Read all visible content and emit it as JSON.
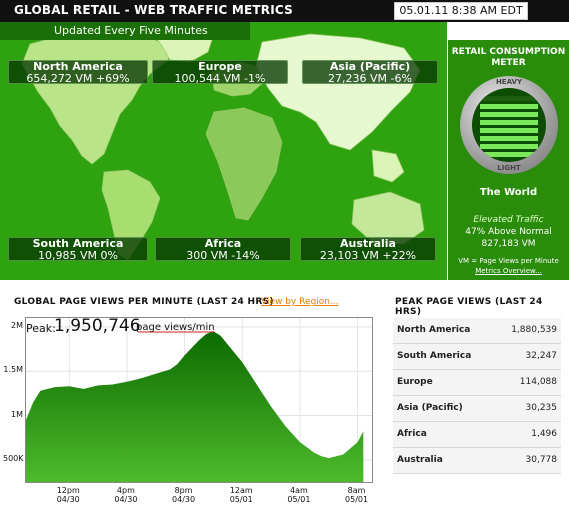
{
  "header": {
    "title": "GLOBAL RETAIL - WEB TRAFFIC METRICS",
    "datetime": "05.01.11 8:38 AM EDT"
  },
  "map": {
    "updated": "Updated Every Five Minutes",
    "regions": [
      {
        "name": "North America",
        "value": "654,272 VM +69%"
      },
      {
        "name": "Europe",
        "value": "100,544 VM -1%"
      },
      {
        "name": "Asia (Pacific)",
        "value": "27,236 VM -6%"
      },
      {
        "name": "South America",
        "value": "10,985 VM 0%"
      },
      {
        "name": "Africa",
        "value": "300 VM -14%"
      },
      {
        "name": "Australia",
        "value": "23,103 VM +22%"
      }
    ]
  },
  "meter": {
    "title_line1": "RETAIL CONSUMPTION",
    "title_line2": "METER",
    "heavy": "HEAVY",
    "light": "LIGHT",
    "level": 0.85,
    "world": "The World",
    "status": "Elevated Traffic",
    "status_detail": "47% Above Normal",
    "total": "827,183 VM",
    "legend": "VM = Page Views per Minute",
    "overview_link": "Metrics Overview..."
  },
  "chart_section": {
    "title": "GLOBAL PAGE VIEWS PER MINUTE (LAST 24 HRS)",
    "region_link": "View by Region...",
    "peak_label": "Peak:",
    "peak_value": "1,950,746",
    "peak_unit": "page views/min"
  },
  "chart_data": {
    "type": "area",
    "title": "GLOBAL PAGE VIEWS PER MINUTE (LAST 24 HRS)",
    "xlabel": "",
    "ylabel": "",
    "ylim": [
      250000,
      2100000
    ],
    "yticks": [
      {
        "label": "2M",
        "value": 2000000
      },
      {
        "label": "1.5M",
        "value": 1500000
      },
      {
        "label": "1M",
        "value": 1000000
      },
      {
        "label": "500K",
        "value": 500000
      }
    ],
    "xticks": [
      {
        "time": "12pm",
        "date": "04/30",
        "hour": 3
      },
      {
        "time": "4pm",
        "date": "04/30",
        "hour": 7
      },
      {
        "time": "8pm",
        "date": "04/30",
        "hour": 11
      },
      {
        "time": "12am",
        "date": "05/01",
        "hour": 15
      },
      {
        "time": "4am",
        "date": "05/01",
        "hour": 19
      },
      {
        "time": "8am",
        "date": "05/01",
        "hour": 23
      }
    ],
    "x_hours": [
      0,
      0.5,
      1,
      2,
      3,
      4,
      5,
      6,
      7,
      8,
      9,
      10,
      10.5,
      11,
      12,
      12.5,
      13,
      13.5,
      14,
      15,
      16,
      17,
      18,
      19,
      20,
      20.5,
      21,
      22,
      23,
      23.4
    ],
    "values": [
      950000,
      1150000,
      1280000,
      1320000,
      1330000,
      1300000,
      1340000,
      1350000,
      1380000,
      1420000,
      1470000,
      1520000,
      1580000,
      1680000,
      1850000,
      1920000,
      1950746,
      1900000,
      1800000,
      1600000,
      1350000,
      1100000,
      880000,
      700000,
      580000,
      540000,
      520000,
      560000,
      700000,
      820000
    ],
    "peak": 1950746,
    "grid": true,
    "color": "#1a8a0a"
  },
  "peak_table": {
    "title": "PEAK PAGE VIEWS (LAST 24 HRS)",
    "rows": [
      {
        "region": "North America",
        "value": "1,880,539"
      },
      {
        "region": "South America",
        "value": "32,247"
      },
      {
        "region": "Europe",
        "value": "114,088"
      },
      {
        "region": "Asia (Pacific)",
        "value": "30,235"
      },
      {
        "region": "Africa",
        "value": "1,496"
      },
      {
        "region": "Australia",
        "value": "30,778"
      }
    ]
  },
  "colors": {
    "map_green": "#2fa30f",
    "land": "#c8ec9a",
    "accent_orange": "#e07f00",
    "area_green": "#1a8a0a"
  }
}
